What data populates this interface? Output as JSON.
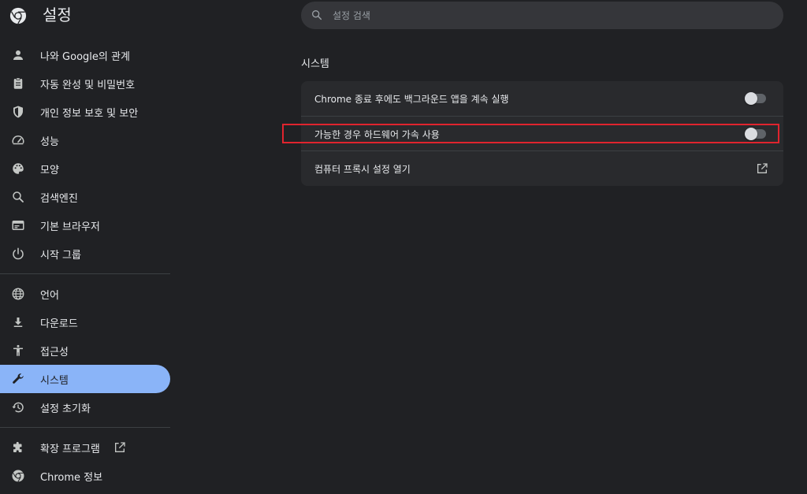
{
  "header": {
    "title": "설정",
    "logo_icon": "chrome-logo-icon",
    "search": {
      "placeholder": "설정 검색",
      "value": ""
    }
  },
  "sidebar": {
    "groups": [
      [
        {
          "label": "나와 Google의 관계",
          "icon": "person-icon"
        },
        {
          "label": "자동 완성 및 비밀번호",
          "icon": "clipboard-icon"
        },
        {
          "label": "개인 정보 보호 및 보안",
          "icon": "shield-icon"
        },
        {
          "label": "성능",
          "icon": "speedometer-icon"
        },
        {
          "label": "모양",
          "icon": "palette-icon"
        },
        {
          "label": "검색엔진",
          "icon": "search-icon"
        },
        {
          "label": "기본 브라우저",
          "icon": "browser-icon"
        },
        {
          "label": "시작 그룹",
          "icon": "power-icon"
        }
      ],
      [
        {
          "label": "언어",
          "icon": "globe-icon"
        },
        {
          "label": "다운로드",
          "icon": "download-icon"
        },
        {
          "label": "접근성",
          "icon": "accessibility-icon"
        },
        {
          "label": "시스템",
          "icon": "wrench-icon",
          "active": true
        },
        {
          "label": "설정 초기화",
          "icon": "restore-icon"
        }
      ],
      [
        {
          "label": "확장 프로그램",
          "icon": "puzzle-icon",
          "external": true
        },
        {
          "label": "Chrome 정보",
          "icon": "chrome-icon"
        }
      ]
    ]
  },
  "main": {
    "section_title": "시스템",
    "rows": [
      {
        "label": "Chrome 종료 후에도 백그라운드 앱을 계속 실행",
        "control": "toggle",
        "on": false
      },
      {
        "label": "가능한 경우 하드웨어 가속 사용",
        "control": "toggle",
        "on": false,
        "highlighted": true
      },
      {
        "label": "컴퓨터 프록시 설정 열기",
        "control": "open-external"
      }
    ]
  },
  "colors": {
    "background": "#202124",
    "card": "#292a2d",
    "accent": "#8ab4f8",
    "highlight_border": "#e0242e",
    "text": "#e8eaed",
    "icon": "#c4c7c5"
  }
}
